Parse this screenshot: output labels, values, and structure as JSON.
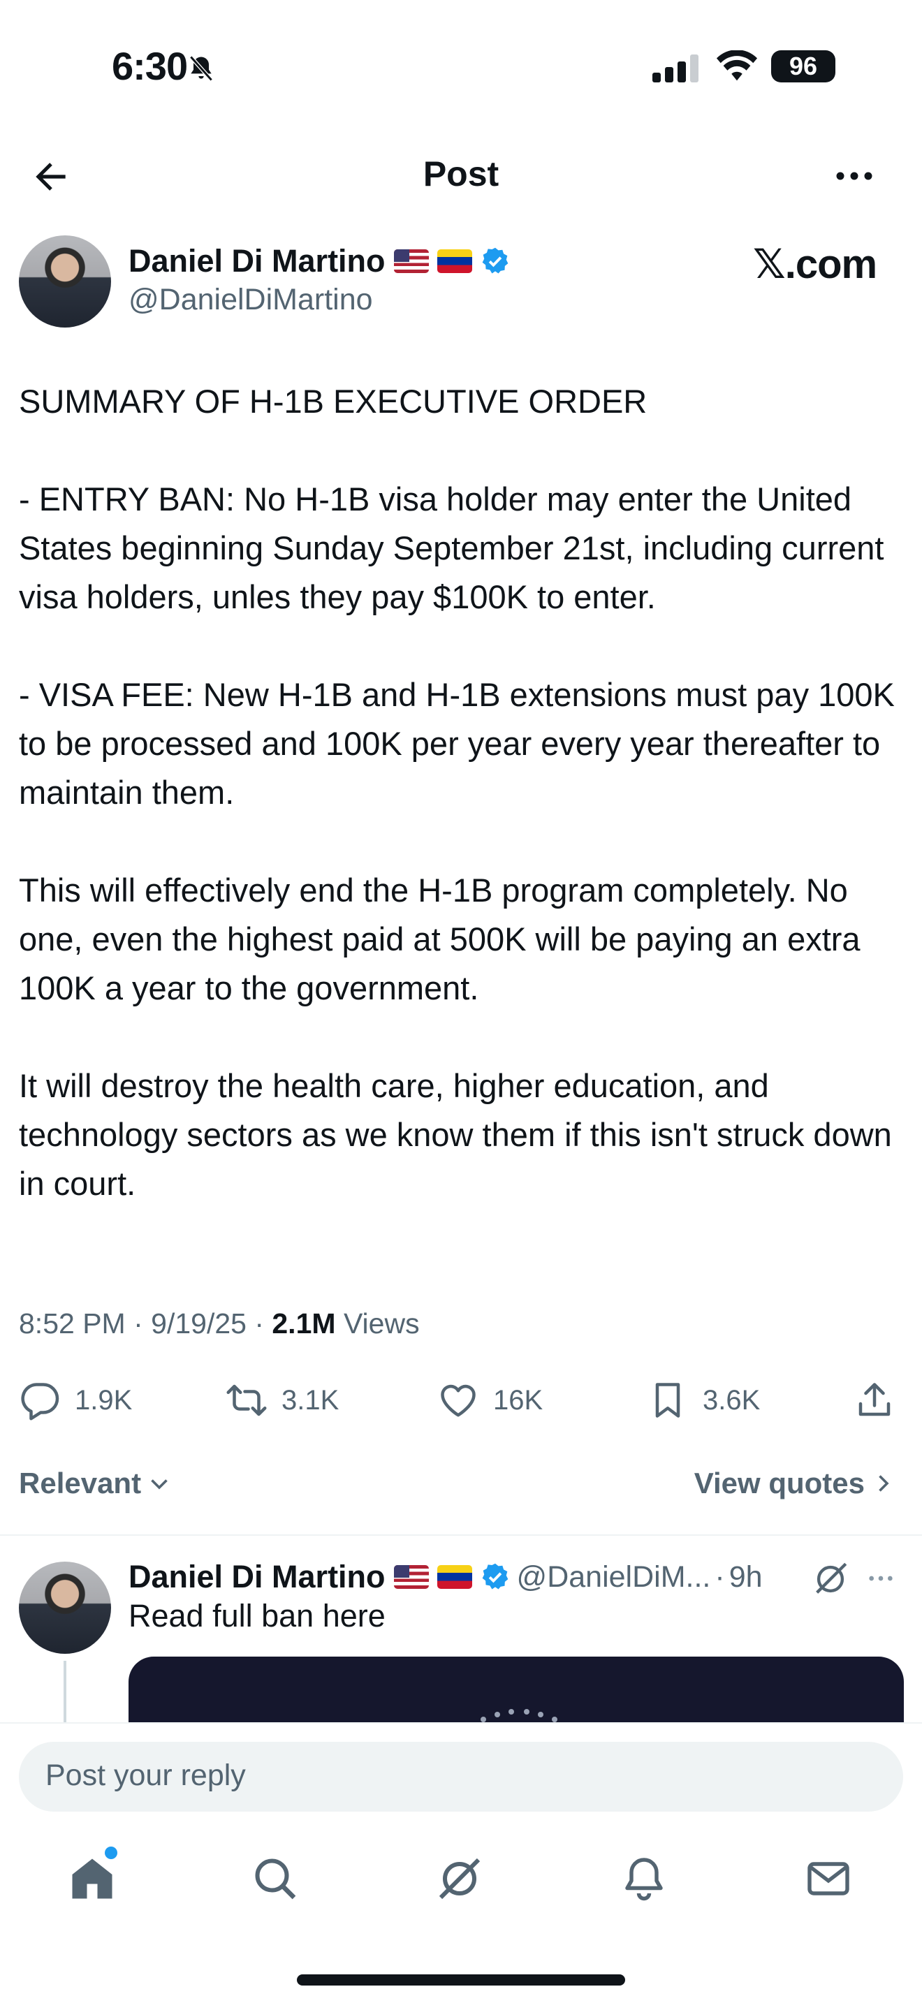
{
  "status_bar": {
    "time": "6:30",
    "battery": "96"
  },
  "nav": {
    "title": "Post"
  },
  "post": {
    "author_name": "Daniel Di Martino",
    "author_handle": "@DanielDiMartino",
    "watermark": "𝕏.com",
    "body": "SUMMARY OF H-1B EXECUTIVE ORDER\n\n- ENTRY BAN: No H-1B visa holder may enter the United States beginning Sunday September 21st, including current visa holders, unles they pay $100K to enter.\n\n- VISA FEE: New H-1B and H-1B extensions must pay 100K to be processed and 100K per year every year thereafter to maintain them.\n\nThis will effectively end the H-1B program completely. No one, even the highest paid at 500K will be paying an extra 100K a year to the government.\n\nIt will destroy the health care, higher education, and technology sectors as we know them if this isn't struck down in court.",
    "time": "8:52 PM",
    "date": "9/19/25",
    "views_count": "2.1M",
    "views_label": "Views"
  },
  "actions": {
    "replies": "1.9K",
    "reposts": "3.1K",
    "likes": "16K",
    "bookmarks": "3.6K"
  },
  "filters": {
    "sort_label": "Relevant",
    "quotes_label": "View quotes"
  },
  "reply": {
    "author_name": "Daniel Di Martino",
    "author_handle": "@DanielDiM...",
    "age": "9h",
    "text": "Read full ban here"
  },
  "composer": {
    "placeholder": "Post your reply"
  },
  "colors": {
    "verified": "#1d9bf0",
    "accent_dot": "#1d9bf0",
    "card_bg": "#15172d"
  }
}
